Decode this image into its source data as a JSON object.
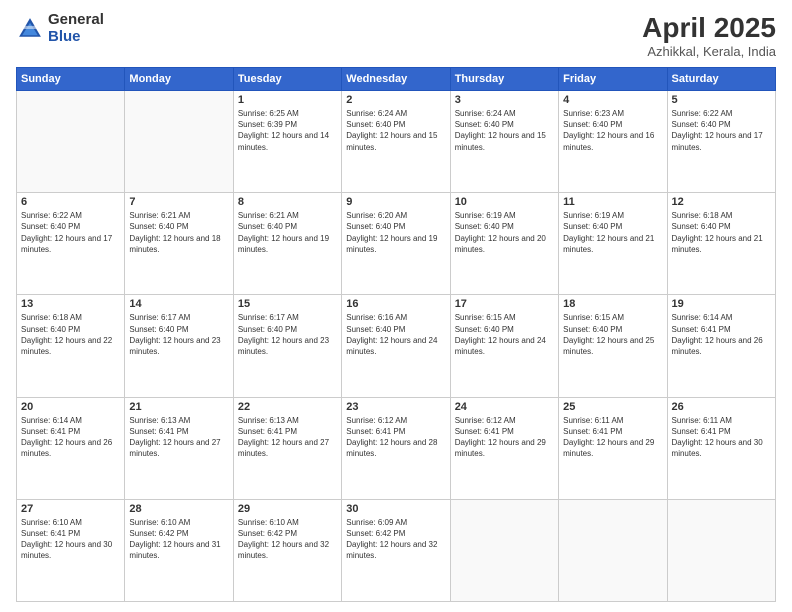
{
  "header": {
    "logo_general": "General",
    "logo_blue": "Blue",
    "title": "April 2025",
    "location": "Azhikkal, Kerala, India"
  },
  "weekdays": [
    "Sunday",
    "Monday",
    "Tuesday",
    "Wednesday",
    "Thursday",
    "Friday",
    "Saturday"
  ],
  "weeks": [
    [
      {
        "day": "",
        "sunrise": "",
        "sunset": "",
        "daylight": ""
      },
      {
        "day": "",
        "sunrise": "",
        "sunset": "",
        "daylight": ""
      },
      {
        "day": "1",
        "sunrise": "Sunrise: 6:25 AM",
        "sunset": "Sunset: 6:39 PM",
        "daylight": "Daylight: 12 hours and 14 minutes."
      },
      {
        "day": "2",
        "sunrise": "Sunrise: 6:24 AM",
        "sunset": "Sunset: 6:40 PM",
        "daylight": "Daylight: 12 hours and 15 minutes."
      },
      {
        "day": "3",
        "sunrise": "Sunrise: 6:24 AM",
        "sunset": "Sunset: 6:40 PM",
        "daylight": "Daylight: 12 hours and 15 minutes."
      },
      {
        "day": "4",
        "sunrise": "Sunrise: 6:23 AM",
        "sunset": "Sunset: 6:40 PM",
        "daylight": "Daylight: 12 hours and 16 minutes."
      },
      {
        "day": "5",
        "sunrise": "Sunrise: 6:22 AM",
        "sunset": "Sunset: 6:40 PM",
        "daylight": "Daylight: 12 hours and 17 minutes."
      }
    ],
    [
      {
        "day": "6",
        "sunrise": "Sunrise: 6:22 AM",
        "sunset": "Sunset: 6:40 PM",
        "daylight": "Daylight: 12 hours and 17 minutes."
      },
      {
        "day": "7",
        "sunrise": "Sunrise: 6:21 AM",
        "sunset": "Sunset: 6:40 PM",
        "daylight": "Daylight: 12 hours and 18 minutes."
      },
      {
        "day": "8",
        "sunrise": "Sunrise: 6:21 AM",
        "sunset": "Sunset: 6:40 PM",
        "daylight": "Daylight: 12 hours and 19 minutes."
      },
      {
        "day": "9",
        "sunrise": "Sunrise: 6:20 AM",
        "sunset": "Sunset: 6:40 PM",
        "daylight": "Daylight: 12 hours and 19 minutes."
      },
      {
        "day": "10",
        "sunrise": "Sunrise: 6:19 AM",
        "sunset": "Sunset: 6:40 PM",
        "daylight": "Daylight: 12 hours and 20 minutes."
      },
      {
        "day": "11",
        "sunrise": "Sunrise: 6:19 AM",
        "sunset": "Sunset: 6:40 PM",
        "daylight": "Daylight: 12 hours and 21 minutes."
      },
      {
        "day": "12",
        "sunrise": "Sunrise: 6:18 AM",
        "sunset": "Sunset: 6:40 PM",
        "daylight": "Daylight: 12 hours and 21 minutes."
      }
    ],
    [
      {
        "day": "13",
        "sunrise": "Sunrise: 6:18 AM",
        "sunset": "Sunset: 6:40 PM",
        "daylight": "Daylight: 12 hours and 22 minutes."
      },
      {
        "day": "14",
        "sunrise": "Sunrise: 6:17 AM",
        "sunset": "Sunset: 6:40 PM",
        "daylight": "Daylight: 12 hours and 23 minutes."
      },
      {
        "day": "15",
        "sunrise": "Sunrise: 6:17 AM",
        "sunset": "Sunset: 6:40 PM",
        "daylight": "Daylight: 12 hours and 23 minutes."
      },
      {
        "day": "16",
        "sunrise": "Sunrise: 6:16 AM",
        "sunset": "Sunset: 6:40 PM",
        "daylight": "Daylight: 12 hours and 24 minutes."
      },
      {
        "day": "17",
        "sunrise": "Sunrise: 6:15 AM",
        "sunset": "Sunset: 6:40 PM",
        "daylight": "Daylight: 12 hours and 24 minutes."
      },
      {
        "day": "18",
        "sunrise": "Sunrise: 6:15 AM",
        "sunset": "Sunset: 6:40 PM",
        "daylight": "Daylight: 12 hours and 25 minutes."
      },
      {
        "day": "19",
        "sunrise": "Sunrise: 6:14 AM",
        "sunset": "Sunset: 6:41 PM",
        "daylight": "Daylight: 12 hours and 26 minutes."
      }
    ],
    [
      {
        "day": "20",
        "sunrise": "Sunrise: 6:14 AM",
        "sunset": "Sunset: 6:41 PM",
        "daylight": "Daylight: 12 hours and 26 minutes."
      },
      {
        "day": "21",
        "sunrise": "Sunrise: 6:13 AM",
        "sunset": "Sunset: 6:41 PM",
        "daylight": "Daylight: 12 hours and 27 minutes."
      },
      {
        "day": "22",
        "sunrise": "Sunrise: 6:13 AM",
        "sunset": "Sunset: 6:41 PM",
        "daylight": "Daylight: 12 hours and 27 minutes."
      },
      {
        "day": "23",
        "sunrise": "Sunrise: 6:12 AM",
        "sunset": "Sunset: 6:41 PM",
        "daylight": "Daylight: 12 hours and 28 minutes."
      },
      {
        "day": "24",
        "sunrise": "Sunrise: 6:12 AM",
        "sunset": "Sunset: 6:41 PM",
        "daylight": "Daylight: 12 hours and 29 minutes."
      },
      {
        "day": "25",
        "sunrise": "Sunrise: 6:11 AM",
        "sunset": "Sunset: 6:41 PM",
        "daylight": "Daylight: 12 hours and 29 minutes."
      },
      {
        "day": "26",
        "sunrise": "Sunrise: 6:11 AM",
        "sunset": "Sunset: 6:41 PM",
        "daylight": "Daylight: 12 hours and 30 minutes."
      }
    ],
    [
      {
        "day": "27",
        "sunrise": "Sunrise: 6:10 AM",
        "sunset": "Sunset: 6:41 PM",
        "daylight": "Daylight: 12 hours and 30 minutes."
      },
      {
        "day": "28",
        "sunrise": "Sunrise: 6:10 AM",
        "sunset": "Sunset: 6:42 PM",
        "daylight": "Daylight: 12 hours and 31 minutes."
      },
      {
        "day": "29",
        "sunrise": "Sunrise: 6:10 AM",
        "sunset": "Sunset: 6:42 PM",
        "daylight": "Daylight: 12 hours and 32 minutes."
      },
      {
        "day": "30",
        "sunrise": "Sunrise: 6:09 AM",
        "sunset": "Sunset: 6:42 PM",
        "daylight": "Daylight: 12 hours and 32 minutes."
      },
      {
        "day": "",
        "sunrise": "",
        "sunset": "",
        "daylight": ""
      },
      {
        "day": "",
        "sunrise": "",
        "sunset": "",
        "daylight": ""
      },
      {
        "day": "",
        "sunrise": "",
        "sunset": "",
        "daylight": ""
      }
    ]
  ]
}
